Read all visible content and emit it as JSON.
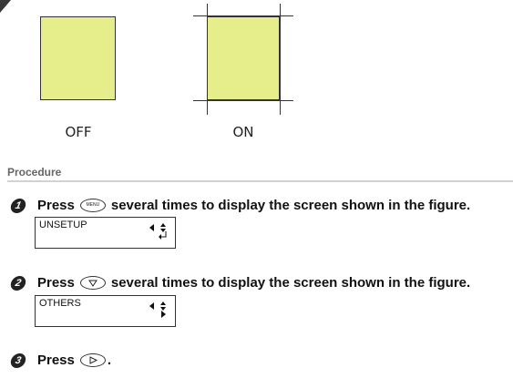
{
  "figure": {
    "off_label": "OFF",
    "on_label": "ON",
    "swatch_color": "#e6ee8c"
  },
  "procedure": {
    "title": "Procedure",
    "steps": [
      {
        "number": "1",
        "text_before": "Press",
        "key": "menu-key-icon",
        "key_text": "MENU",
        "text_after": "several times to display the screen shown in the figure.",
        "screen": {
          "text": "UNSETUP",
          "bottom_icon": "enter-icon"
        }
      },
      {
        "number": "2",
        "text_before": "Press",
        "key": "down-key-icon",
        "text_after": "several times to display the screen shown in the figure.",
        "screen": {
          "text": "OTHERS",
          "bottom_icon": "right-arrow-icon"
        }
      },
      {
        "number": "3",
        "text_before": "Press",
        "key": "right-key-icon",
        "text_after": "."
      }
    ]
  }
}
